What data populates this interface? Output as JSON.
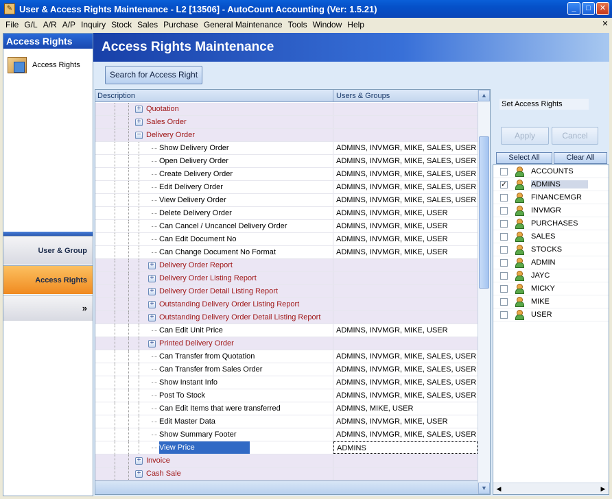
{
  "window": {
    "title": "User & Access Rights Maintenance - L2 [13506] - AutoCount Accounting (Ver: 1.5.21)",
    "minimize": "_",
    "maximize": "□",
    "close": "✕"
  },
  "menu": {
    "items": [
      "File",
      "G/L",
      "A/R",
      "A/P",
      "Inquiry",
      "Stock",
      "Sales",
      "Purchase",
      "General Maintenance",
      "Tools",
      "Window",
      "Help"
    ],
    "close_glyph": "✕"
  },
  "sidebar": {
    "header": "Access Rights",
    "item_label": "Access Rights",
    "user_group_label": "User & Group",
    "access_rights_label": "Access Rights",
    "more_glyph": "»"
  },
  "main": {
    "title": "Access Rights Maintenance",
    "search_button": "Search for Access Right"
  },
  "grid": {
    "col_description": "Description",
    "col_users": "Users & Groups",
    "rows": [
      {
        "label": "Quotation",
        "users": "",
        "level": 1,
        "type": "group",
        "expander": "+"
      },
      {
        "label": "Sales Order",
        "users": "",
        "level": 1,
        "type": "group",
        "expander": "+"
      },
      {
        "label": "Delivery Order",
        "users": "",
        "level": 1,
        "type": "group",
        "expander": "−"
      },
      {
        "label": "Show Delivery Order",
        "users": "ADMINS, INVMGR, MIKE, SALES, USER",
        "level": 2,
        "type": "leaf"
      },
      {
        "label": "Open Delivery Order",
        "users": "ADMINS, INVMGR, MIKE, SALES, USER",
        "level": 2,
        "type": "leaf"
      },
      {
        "label": "Create Delivery Order",
        "users": "ADMINS, INVMGR, MIKE, SALES, USER",
        "level": 2,
        "type": "leaf"
      },
      {
        "label": "Edit Delivery Order",
        "users": "ADMINS, INVMGR, MIKE, SALES, USER",
        "level": 2,
        "type": "leaf"
      },
      {
        "label": "View Delivery Order",
        "users": "ADMINS, INVMGR, MIKE, SALES, USER",
        "level": 2,
        "type": "leaf"
      },
      {
        "label": "Delete Delivery Order",
        "users": "ADMINS, INVMGR, MIKE, USER",
        "level": 2,
        "type": "leaf"
      },
      {
        "label": "Can Cancel / Uncancel Delivery Order",
        "users": "ADMINS, INVMGR, MIKE, USER",
        "level": 2,
        "type": "leaf"
      },
      {
        "label": "Can Edit Document No",
        "users": "ADMINS, INVMGR, MIKE, USER",
        "level": 2,
        "type": "leaf"
      },
      {
        "label": "Can Change Document No Format",
        "users": "ADMINS, INVMGR, MIKE, USER",
        "level": 2,
        "type": "leaf"
      },
      {
        "label": "Delivery Order Report",
        "users": "",
        "level": 2,
        "type": "group",
        "expander": "+"
      },
      {
        "label": "Delivery Order Listing Report",
        "users": "",
        "level": 2,
        "type": "group",
        "expander": "+"
      },
      {
        "label": "Delivery Order Detail Listing Report",
        "users": "",
        "level": 2,
        "type": "group",
        "expander": "+"
      },
      {
        "label": "Outstanding Delivery Order Listing Report",
        "users": "",
        "level": 2,
        "type": "group",
        "expander": "+"
      },
      {
        "label": "Outstanding Delivery Order Detail Listing Report",
        "users": "",
        "level": 2,
        "type": "group",
        "expander": "+"
      },
      {
        "label": "Can Edit Unit Price",
        "users": "ADMINS, INVMGR, MIKE, USER",
        "level": 2,
        "type": "leaf"
      },
      {
        "label": "Printed Delivery Order",
        "users": "",
        "level": 2,
        "type": "group",
        "expander": "+"
      },
      {
        "label": "Can Transfer from Quotation",
        "users": "ADMINS, INVMGR, MIKE, SALES, USER",
        "level": 2,
        "type": "leaf"
      },
      {
        "label": "Can Transfer from Sales Order",
        "users": "ADMINS, INVMGR, MIKE, SALES, USER",
        "level": 2,
        "type": "leaf"
      },
      {
        "label": "Show Instant Info",
        "users": "ADMINS, INVMGR, MIKE, SALES, USER",
        "level": 2,
        "type": "leaf"
      },
      {
        "label": "Post To Stock",
        "users": "ADMINS, INVMGR, MIKE, SALES, USER",
        "level": 2,
        "type": "leaf"
      },
      {
        "label": "Can Edit Items that were transferred",
        "users": "ADMINS, MIKE, USER",
        "level": 2,
        "type": "leaf"
      },
      {
        "label": "Edit Master Data",
        "users": "ADMINS, INVMGR, MIKE, USER",
        "level": 2,
        "type": "leaf"
      },
      {
        "label": "Show Summary Footer",
        "users": "ADMINS, INVMGR, MIKE, SALES, USER",
        "level": 2,
        "type": "leaf"
      },
      {
        "label": "View Price",
        "users": "ADMINS",
        "level": 2,
        "type": "leaf",
        "selected": true
      },
      {
        "label": "Invoice",
        "users": "",
        "level": 1,
        "type": "group",
        "expander": "+"
      },
      {
        "label": "Cash Sale",
        "users": "",
        "level": 1,
        "type": "group",
        "expander": "+"
      }
    ]
  },
  "rights_panel": {
    "set_label": "Set Access Rights",
    "apply": "Apply",
    "cancel": "Cancel",
    "select_all": "Select All",
    "clear_all": "Clear All",
    "users": [
      {
        "name": "ACCOUNTS",
        "checked": false
      },
      {
        "name": "ADMINS",
        "checked": true,
        "selected": true
      },
      {
        "name": "FINANCEMGR",
        "checked": false
      },
      {
        "name": "INVMGR",
        "checked": false
      },
      {
        "name": "PURCHASES",
        "checked": false
      },
      {
        "name": "SALES",
        "checked": false
      },
      {
        "name": "STOCKS",
        "checked": false
      },
      {
        "name": "ADMIN",
        "checked": false
      },
      {
        "name": "JAYC",
        "checked": false
      },
      {
        "name": "MICKY",
        "checked": false
      },
      {
        "name": "MIKE",
        "checked": false
      },
      {
        "name": "USER",
        "checked": false
      }
    ]
  }
}
